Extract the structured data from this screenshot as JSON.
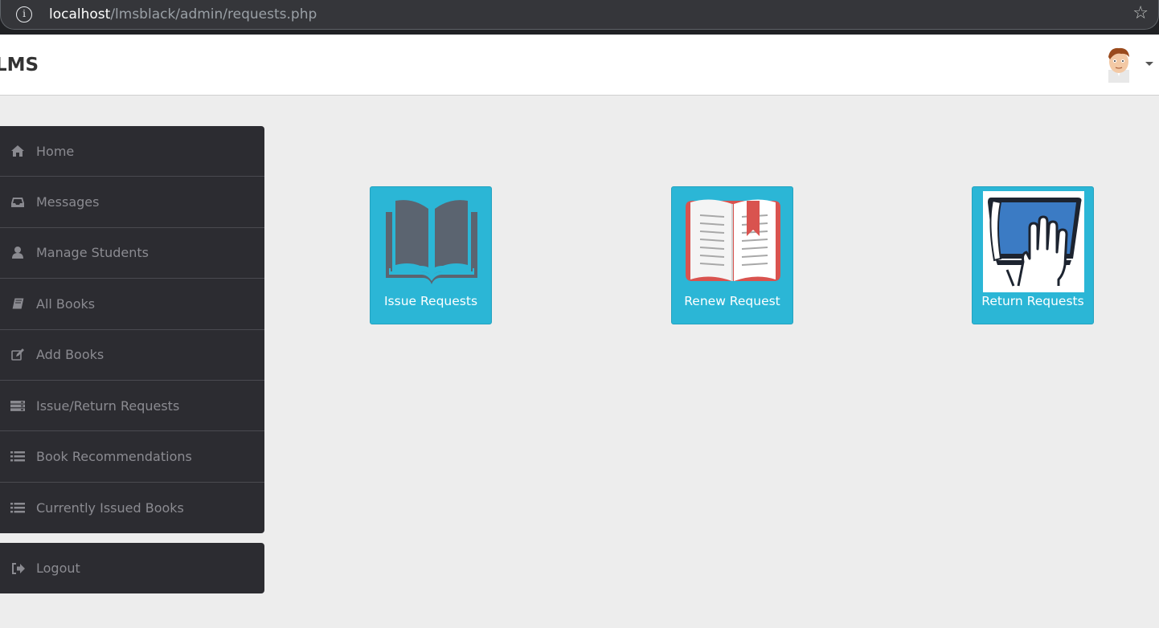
{
  "browser": {
    "url_host": "localhost",
    "url_path": "/lmsblack/admin/requests.php"
  },
  "header": {
    "brand": "LMS",
    "avatar_icon": "user-avatar-icon"
  },
  "sidebar": {
    "items": [
      {
        "label": "Home",
        "icon": "home-icon"
      },
      {
        "label": "Messages",
        "icon": "inbox-icon"
      },
      {
        "label": "Manage Students",
        "icon": "user-icon"
      },
      {
        "label": "All Books",
        "icon": "book-icon"
      },
      {
        "label": "Add Books",
        "icon": "edit-icon"
      },
      {
        "label": "Issue/Return Requests",
        "icon": "server-icon"
      },
      {
        "label": "Book Recommendations",
        "icon": "list-icon"
      },
      {
        "label": "Currently Issued Books",
        "icon": "list-icon"
      }
    ],
    "logout": {
      "label": "Logout",
      "icon": "sign-out-icon"
    }
  },
  "tiles": [
    {
      "label": "Issue Requests",
      "icon": "open-book-icon"
    },
    {
      "label": "Renew Request",
      "icon": "bookmarked-book-icon"
    },
    {
      "label": "Return Requests",
      "icon": "hand-on-book-icon"
    }
  ],
  "colors": {
    "tile": "#2bb6d6",
    "sidebar": "#2c2c31",
    "background": "#ededed"
  }
}
